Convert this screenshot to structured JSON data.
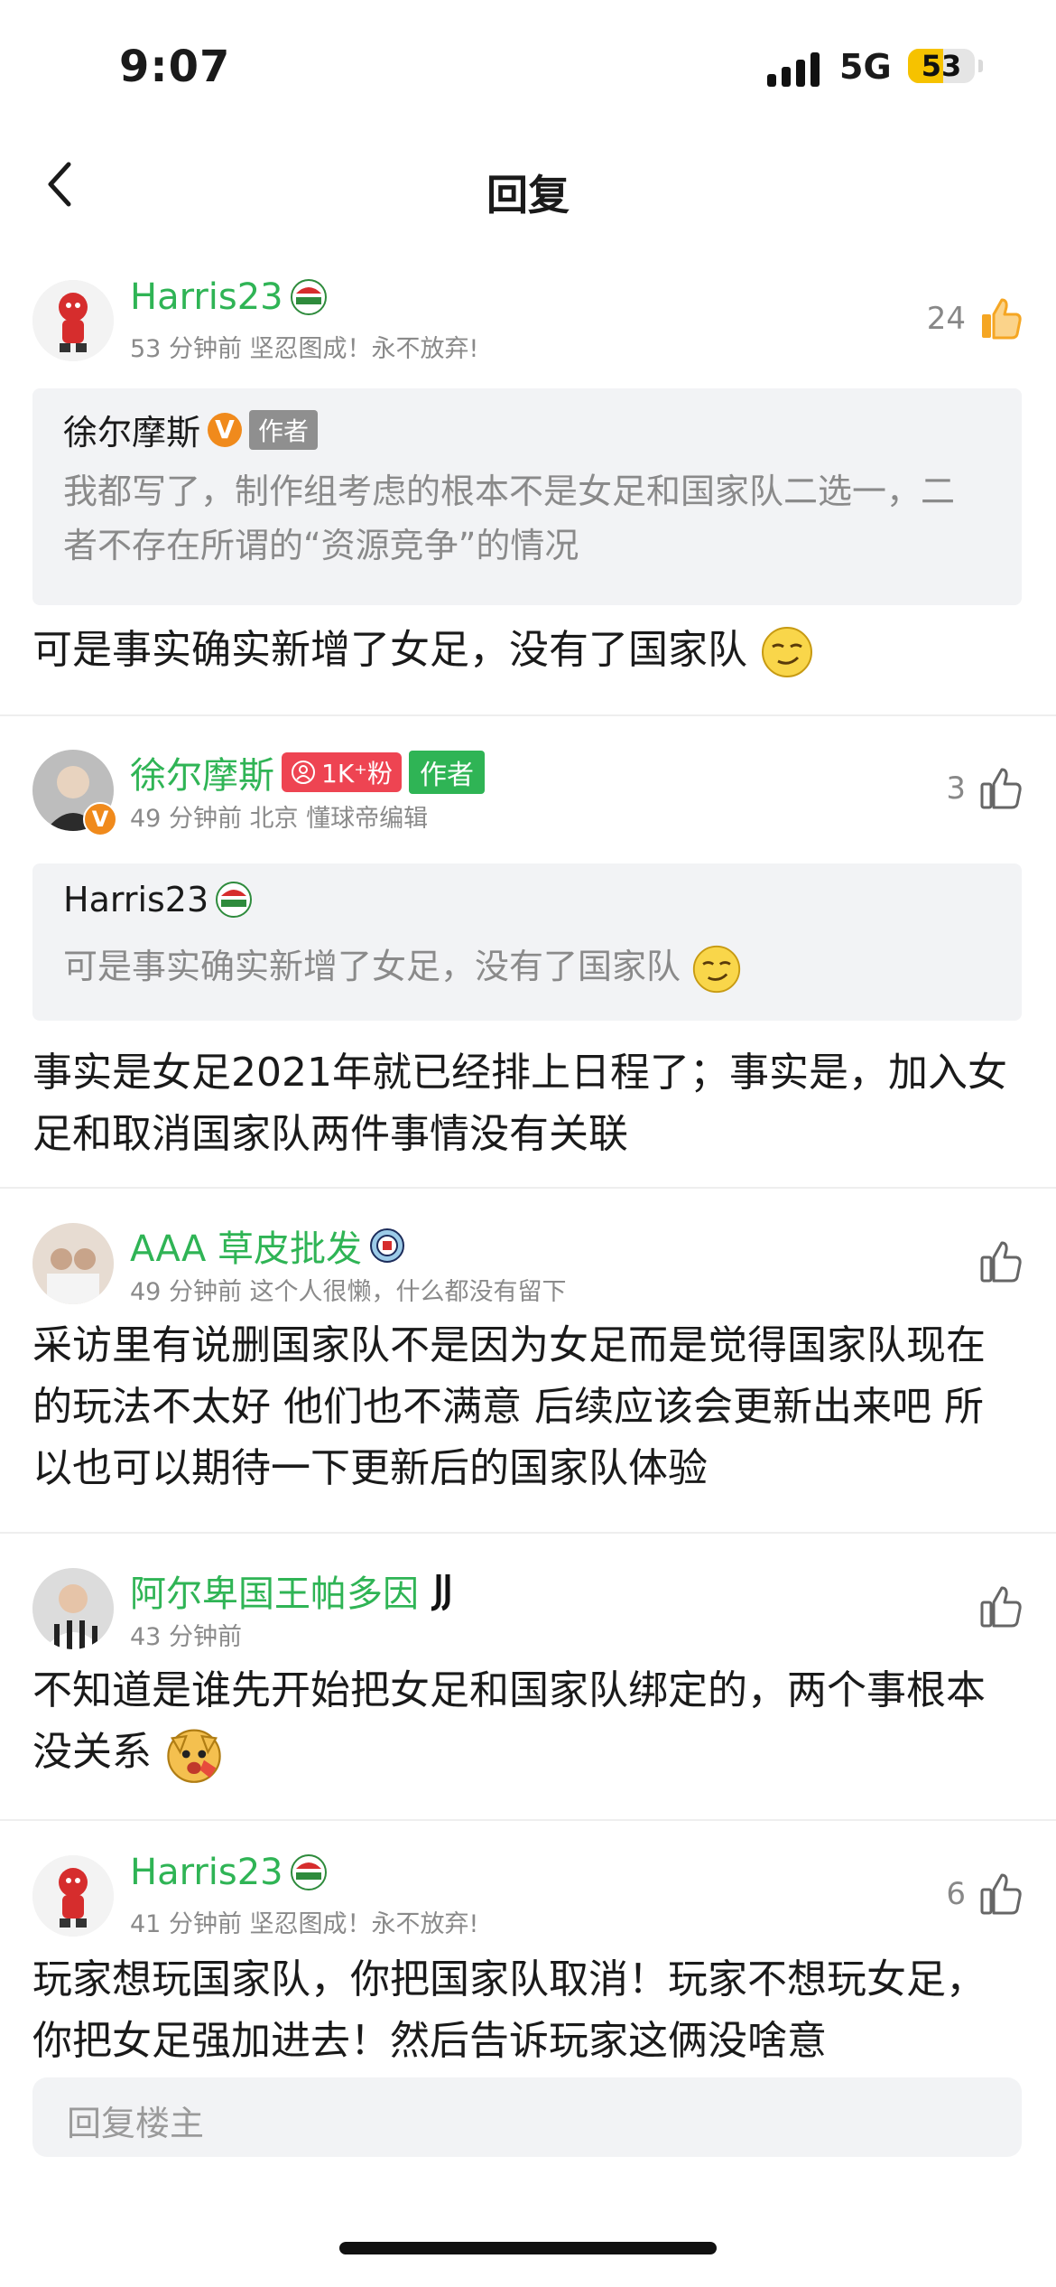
{
  "status_bar": {
    "time": "9:07",
    "network": "5G",
    "battery": "53",
    "battery_level": 0.53
  },
  "nav": {
    "title": "回复"
  },
  "comments": [
    {
      "user": "Harris23",
      "meta": "53 分钟前  坚忍图成！永不放弃!",
      "likes": "24",
      "liked": true,
      "quote": {
        "user": "徐尔摩斯",
        "author_tag": "作者",
        "text": "我都写了，制作组考虑的根本不是女足和国家队二选一，二者不存在所谓的“资源竞争”的情况"
      },
      "text": "可是事实确实新增了女足，没有了国家队"
    },
    {
      "user": "徐尔摩斯",
      "fans_badge": "1K⁺粉",
      "author_tag": "作者",
      "meta": "49 分钟前  北京  懂球帝编辑",
      "likes": "3",
      "quote": {
        "user": "Harris23",
        "text": "可是事实确实新增了女足，没有了国家队"
      },
      "text": "事实是女足2021年就已经排上日程了；事实是，加入女足和取消国家队两件事情没有关联"
    },
    {
      "user": "AAA 草皮批发",
      "meta": "49 分钟前  这个人很懒，什么都没有留下",
      "likes": "",
      "text": "采访里有说删国家队不是因为女足而是觉得国家队现在的玩法不太好 他们也不满意 后续应该会更新出来吧 所以也可以期待一下更新后的国家队体验"
    },
    {
      "user": "阿尔卑国王帕多因",
      "meta": "43 分钟前",
      "likes": "",
      "text": "不知道是谁先开始把女足和国家队绑定的，两个事根本没关系"
    },
    {
      "user": "Harris23",
      "meta": "41 分钟前  坚忍图成！永不放弃!",
      "likes": "6",
      "text": "玩家想玩国家队，你把国家队取消！玩家不想玩女足，你把女足强加进去！然后告诉玩家这俩没啥意"
    }
  ],
  "reply_bar": {
    "placeholder": "回复楼主"
  },
  "colors": {
    "username": "#2fb455",
    "liked": "#f5a623",
    "meta": "#8a8a8a",
    "quote_bg": "#f2f3f5"
  }
}
